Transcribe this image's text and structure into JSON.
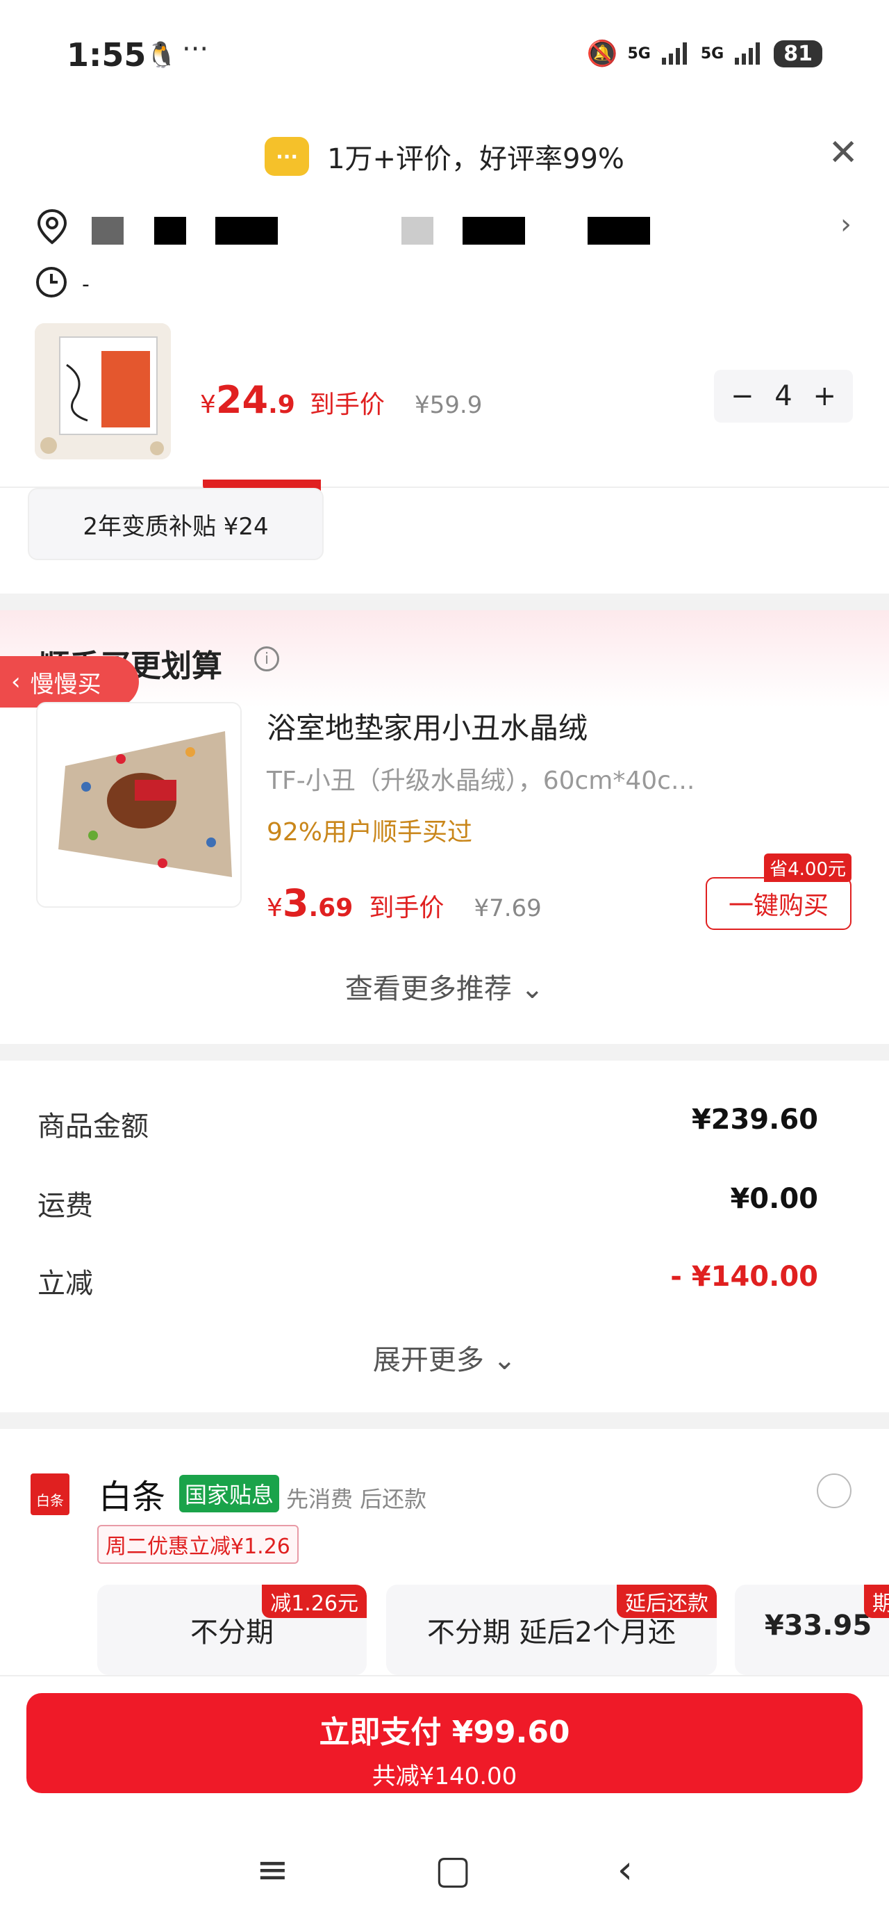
{
  "status_bar": {
    "time": "1:55",
    "battery": "81",
    "network_1": "5G",
    "network_2": "5G"
  },
  "toast": {
    "text": "1万+评价，好评率99%"
  },
  "address": {
    "time_line": "-"
  },
  "product": {
    "price_symbol": "¥",
    "price_main": "24",
    "price_decimal": ".9",
    "price_label": "到手价",
    "original_price": "¥59.9",
    "quantity": "4"
  },
  "subsidy_card": {
    "text": "2年变质补贴  ¥24"
  },
  "addon": {
    "section_title": "顺手买更划算",
    "slow_buy": "慢慢买",
    "title": "浴室地垫家用小丑水晶绒",
    "spec": "TF-小丑（升级水晶绒），60cm*40c...",
    "bought": "92%用户顺手买过",
    "price_symbol": "¥",
    "price_main": "3",
    "price_decimal": ".69",
    "price_label": "到手价",
    "original_price": "¥7.69",
    "save_tag": "省4.00元",
    "buy_button": "一键购买",
    "more": "查看更多推荐"
  },
  "summary": {
    "rows": [
      {
        "label": "商品金额",
        "value": "¥239.60"
      },
      {
        "label": "运费",
        "value": "¥0.00"
      },
      {
        "label": "立减",
        "value": "- ¥140.00"
      }
    ],
    "expand": "展开更多"
  },
  "baitiao": {
    "icon_text": "白条",
    "name": "白条",
    "gov_tag": "国家贴息",
    "desc": "先消费 后还款",
    "promo": "周二优惠立减¥1.26",
    "plans": [
      {
        "title": "不分期",
        "tag": "减1.26元"
      },
      {
        "title": "不分期 延后2个月还",
        "tag": "延后还款"
      },
      {
        "title": "¥33.95",
        "tag": "期"
      }
    ]
  },
  "pay": {
    "label": "立即支付 ¥99.60",
    "sub": "共减¥140.00"
  },
  "colors": {
    "accent": "#e02020",
    "pay_button": "#ef1a28",
    "gov_green": "#1aa34a",
    "toast_yellow": "#f5c12a"
  }
}
